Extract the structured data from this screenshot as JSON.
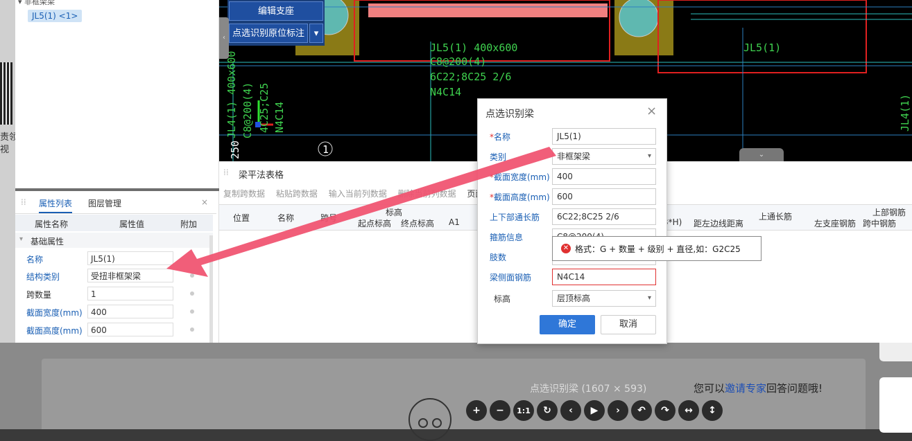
{
  "tree": {
    "group_label": "非框架梁",
    "item_label": "JL5(1) <1>"
  },
  "left_strip": {
    "text": "责领\n视"
  },
  "cad": {
    "btn_edit_support": "编辑支座",
    "btn_pick_annotation": "点选识别原位标注",
    "btn_dropdown": "▾",
    "collapse_glyph": "‹",
    "label_jl5_full": "JL5(1) 400x600",
    "label_stirrup": "C8@200(4)",
    "label_rebar": "6C22;8C25 2/6",
    "label_side": "N4C14",
    "label_jl5_right": "JL5(1)",
    "label_jl4_vertical": "JL4(1) 400x600",
    "label_jl4_stirrup": "C8@200(4)",
    "label_jl4_rebar": "4C25;C25",
    "label_n4": "N4C14",
    "label_250": "250",
    "label_axis_1": "1",
    "label_jl4_right": "JL4(1)",
    "down_glyph": "⌄"
  },
  "table": {
    "title": "梁平法表格",
    "toolbar": [
      "复制跨数据",
      "粘贴跨数据",
      "输入当前列数据",
      "删除当前列数据",
      "页面"
    ],
    "headers": {
      "position": "位置",
      "name": "名称",
      "span": "跨号",
      "elevation": "标高",
      "start_elev": "起点标高",
      "end_elev": "终点标高",
      "a1": "A1",
      "h": "3*H)",
      "dist_left": "距左边线距离",
      "top_through": "上通长筋",
      "top_rebar": "上部钢筋",
      "left_support": "左支座钢筋",
      "mid_span": "跨中钢筋"
    }
  },
  "props": {
    "tab_list": "属性列表",
    "tab_layer": "图层管理",
    "col_name": "属性名称",
    "col_value": "属性值",
    "col_extra": "附加",
    "group": "基础属性",
    "rows": [
      {
        "label": "名称",
        "value": "JL5(1)"
      },
      {
        "label": "结构类别",
        "value": "受扭非框架梁"
      },
      {
        "label": "跨数量",
        "value": "1"
      },
      {
        "label": "截面宽度(mm)",
        "value": "400"
      },
      {
        "label": "截面高度(mm)",
        "value": "600"
      }
    ]
  },
  "dialog": {
    "title": "点选识别梁",
    "close": "×",
    "fields": [
      {
        "label": "名称",
        "required": true,
        "value": "JL5(1)"
      },
      {
        "label": "类别",
        "required": false,
        "value": "非框架梁"
      },
      {
        "label": "截面宽度(mm)",
        "required": true,
        "value": "400"
      },
      {
        "label": "截面高度(mm)",
        "required": true,
        "value": "600"
      },
      {
        "label": "上下部通长筋",
        "required": false,
        "value": "6C22;8C25 2/6"
      },
      {
        "label": "箍筋信息",
        "required": false,
        "value": "C8@200(4)"
      },
      {
        "label": "肢数",
        "required": false,
        "value": ""
      },
      {
        "label": "梁侧面钢筋",
        "required": false,
        "value": "N4C14"
      },
      {
        "label": "标高",
        "required": false,
        "value": "层顶标高"
      }
    ],
    "tooltip_icon": "✕",
    "tooltip": "格式：G + 数量 + 级别 + 直径,如：G2C25",
    "ok": "确定",
    "cancel": "取消"
  },
  "viewer": {
    "caption": "点选识别梁 (1607 × 593)",
    "expert_prefix": "您可以",
    "expert_link": "邀请专家",
    "expert_suffix": "回答问题哦!",
    "toolbar_icons": [
      "+",
      "−",
      "1:1",
      "↻",
      "‹",
      "▶",
      "›",
      "↶",
      "↷",
      "↔",
      "↕"
    ]
  },
  "colors": {
    "accent": "#2f77d8",
    "error": "#e03030",
    "arrow": "#f0506e",
    "cad_green": "#3fd24f",
    "cad_red": "#e02020"
  }
}
